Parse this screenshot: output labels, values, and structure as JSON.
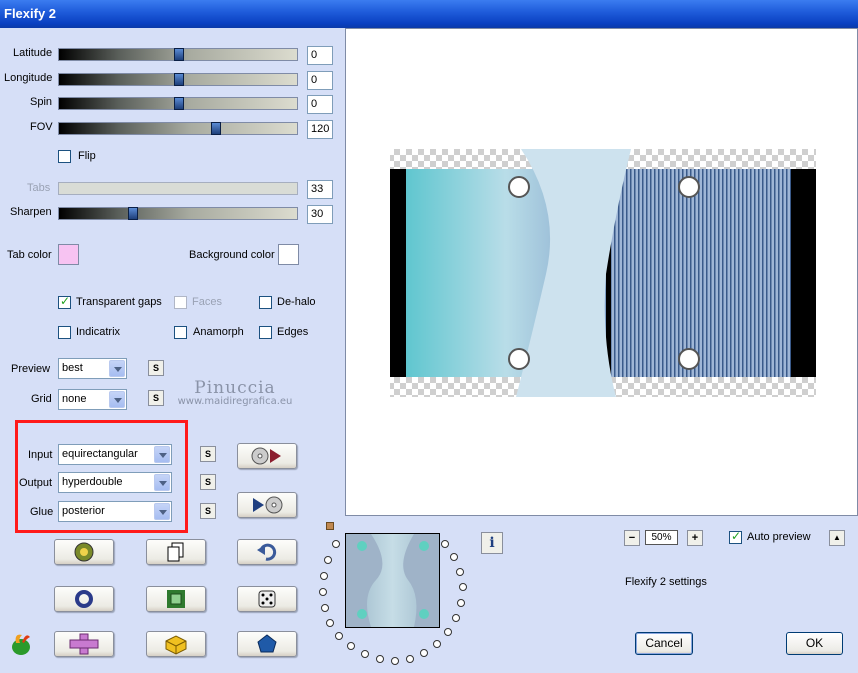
{
  "window": {
    "title": "Flexify 2"
  },
  "sliders": [
    {
      "label": "Latitude",
      "value": "0",
      "level": 0.5
    },
    {
      "label": "Longitude",
      "value": "0",
      "level": 0.5
    },
    {
      "label": "Spin",
      "value": "0",
      "level": 0.5
    },
    {
      "label": "FOV",
      "value": "120",
      "level": 0.67
    }
  ],
  "flip": {
    "label": "Flip",
    "checked": false
  },
  "tabs": {
    "label": "Tabs",
    "value": "33"
  },
  "sharpen": {
    "label": "Sharpen",
    "value": "30",
    "level": 0.3
  },
  "colors": {
    "tab_label": "Tab color",
    "tab_color": "#f7c3f2",
    "bg_label": "Background color",
    "bg_color": "#ffffff"
  },
  "options": {
    "transparent_gaps": "Transparent gaps",
    "faces": "Faces",
    "de_halo": "De-halo",
    "indicatrix": "Indicatrix",
    "anamorph": "Anamorph",
    "edges": "Edges"
  },
  "preview": {
    "label": "Preview",
    "value": "best"
  },
  "grid": {
    "label": "Grid",
    "value": "none"
  },
  "input": {
    "label": "Input",
    "value": "equirectangular"
  },
  "output": {
    "label": "Output",
    "value": "hyperdouble"
  },
  "glue": {
    "label": "Glue",
    "value": "posterior"
  },
  "s_label": "S",
  "watermark": {
    "name": "Pinuccia",
    "url": "www.maidiregrafica.eu"
  },
  "zoom": {
    "value": "50%"
  },
  "auto_preview": {
    "label": "Auto preview",
    "checked": true
  },
  "settings_text": "Flexify 2 settings",
  "buttons": {
    "cancel": "Cancel",
    "ok": "OK"
  },
  "accent": {
    "red_highlight": "#ff1a1a",
    "title_blue": "#0a3fc0"
  }
}
